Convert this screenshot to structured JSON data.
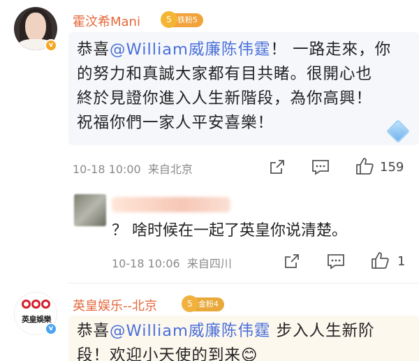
{
  "comments": [
    {
      "username": "霍汶希Mani",
      "badge": {
        "label": "铁粉5",
        "icon_text": "5",
        "color": "#f2a23b"
      },
      "text_prefix": "恭喜",
      "mention": "@William威廉陈伟霆",
      "text_suffix_lines": [
        "！ 一路走來，你",
        "的努力和真誠大家都有目共睹。很開心也",
        "終於見證你進入人生新階段，為你高興！",
        "祝福你們一家人平安喜樂！"
      ],
      "timestamp": "10-18 10:00",
      "location": "来自北京",
      "likes": "159"
    },
    {
      "reply_text": "？ 啥时候在一起了英皇你说清楚。",
      "timestamp": "10-18 10:06",
      "location": "来自四川",
      "likes": "1"
    },
    {
      "username": "英皇娱乐--北京",
      "badge": {
        "label": "金粉4",
        "icon_text": "5",
        "color": "#e8a93a"
      },
      "avatar_text": "英皇娛樂",
      "text_prefix": "恭喜",
      "mention": "@William威廉陈伟霆",
      "text_suffix": " 步入人生新阶",
      "text_line2": "段！欢迎小天使的到来😊"
    }
  ],
  "colors": {
    "username": "#e4683b",
    "mention": "#4a6fd8",
    "bubble_bg": "#f5f7fb"
  }
}
